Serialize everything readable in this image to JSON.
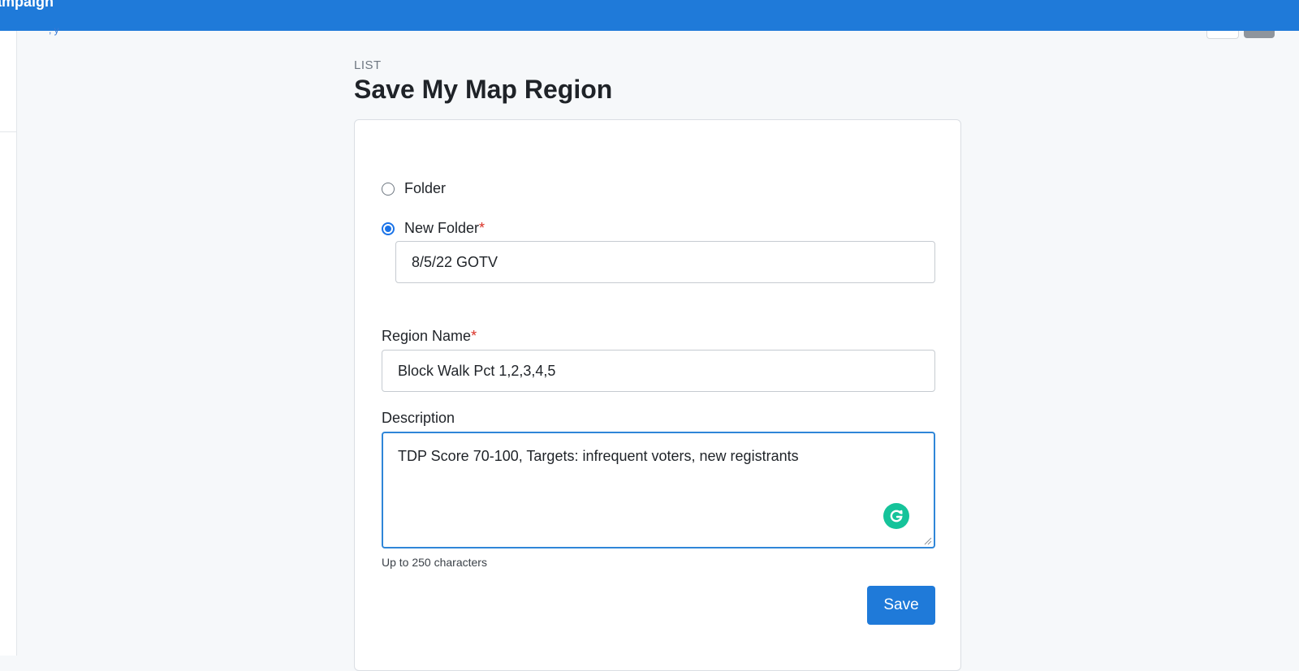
{
  "header": {
    "app_title": "ampaign",
    "sub_breadcrumb": ", y"
  },
  "page": {
    "eyebrow": "LIST",
    "title": "Save My Map Region"
  },
  "form": {
    "folder_option": {
      "label": "Folder",
      "selected": false
    },
    "new_folder_option": {
      "label": "New Folder",
      "required_mark": "*",
      "selected": true,
      "value": "8/5/22 GOTV"
    },
    "region_name": {
      "label": "Region Name",
      "required_mark": "*",
      "value": "Block Walk Pct 1,2,3,4,5"
    },
    "description": {
      "label": "Description",
      "value": "TDP Score 70-100, Targets: infrequent voters, new registrants",
      "hint": "Up to 250 characters"
    },
    "save_label": "Save"
  },
  "colors": {
    "brand_blue": "#1f7ad9",
    "required_red": "#d93025",
    "grammarly_green": "#15c39a"
  },
  "icons": {
    "grammarly": "grammarly-icon",
    "resize": "resize-handle-icon"
  }
}
